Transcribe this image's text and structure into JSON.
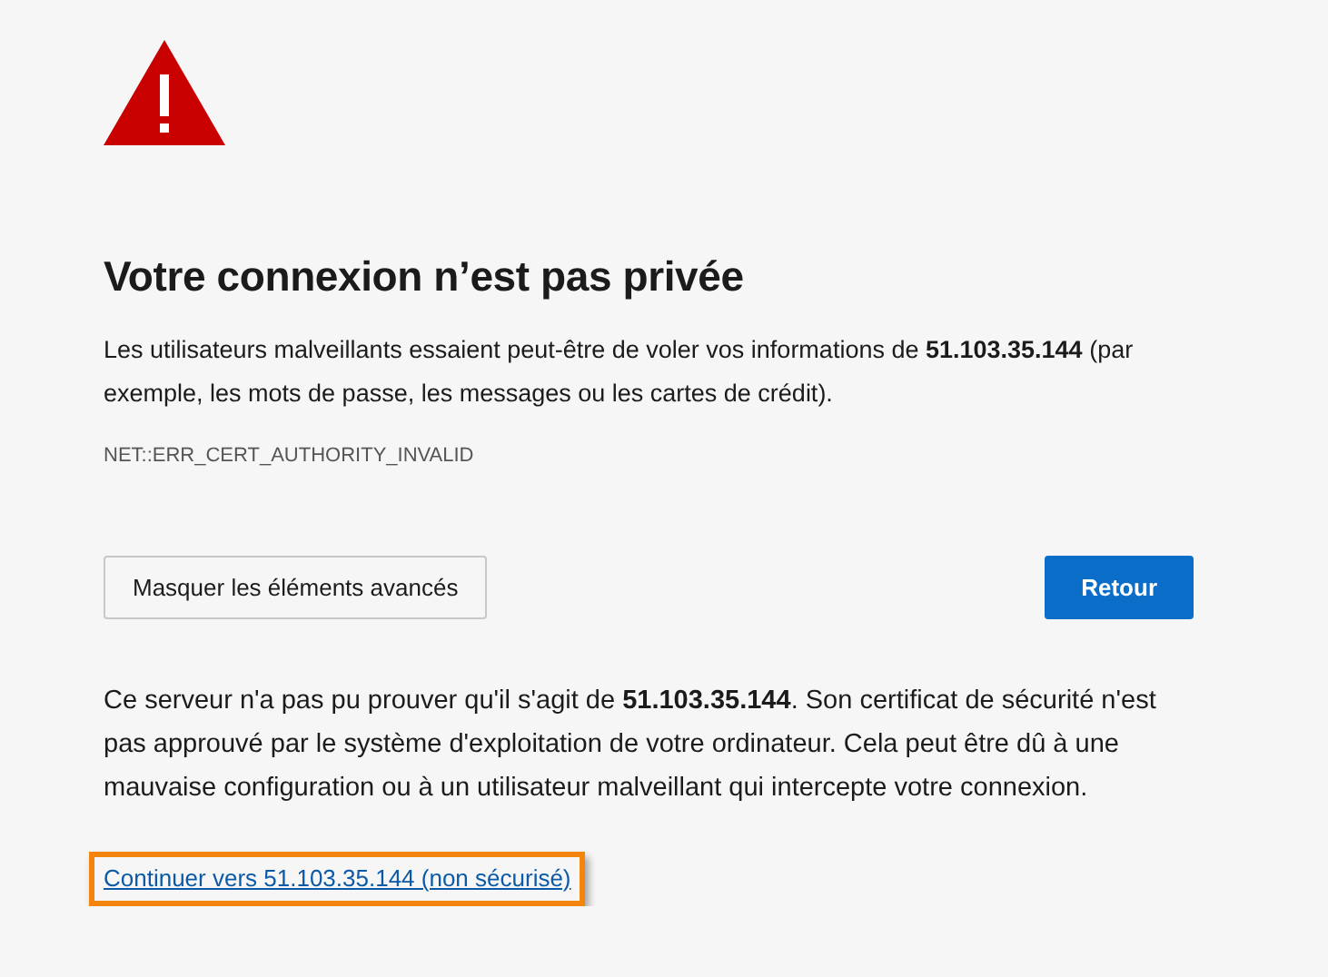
{
  "heading": "Votre connexion n’est pas privée",
  "summary": "Les utilisateurs malveillants essaient peut-être de voler vos informations de **51.103.35.144** (par exemple, les mots de passe, les messages ou les cartes de crédit).",
  "error_code": "NET::ERR_CERT_AUTHORITY_INVALID",
  "buttons": [
    {
      "label": "Masquer les éléments avancés",
      "kind": "secondary"
    },
    {
      "label": "Retour",
      "kind": "primary"
    }
  ],
  "details": "Ce serveur n'a pas pu prouver qu'il s'agit de **51.103.35.144**. Son certificat de sécurité n'est pas approuvé par le système d'exploitation de votre ordinateur. Cela peut être dû à une mauvaise configuration ou à un utilisateur malveillant qui intercepte votre connexion.",
  "proceed_link": {
    "label": "Continuer vers 51.103.35.144 (non sécurisé)",
    "highlighted": true
  }
}
